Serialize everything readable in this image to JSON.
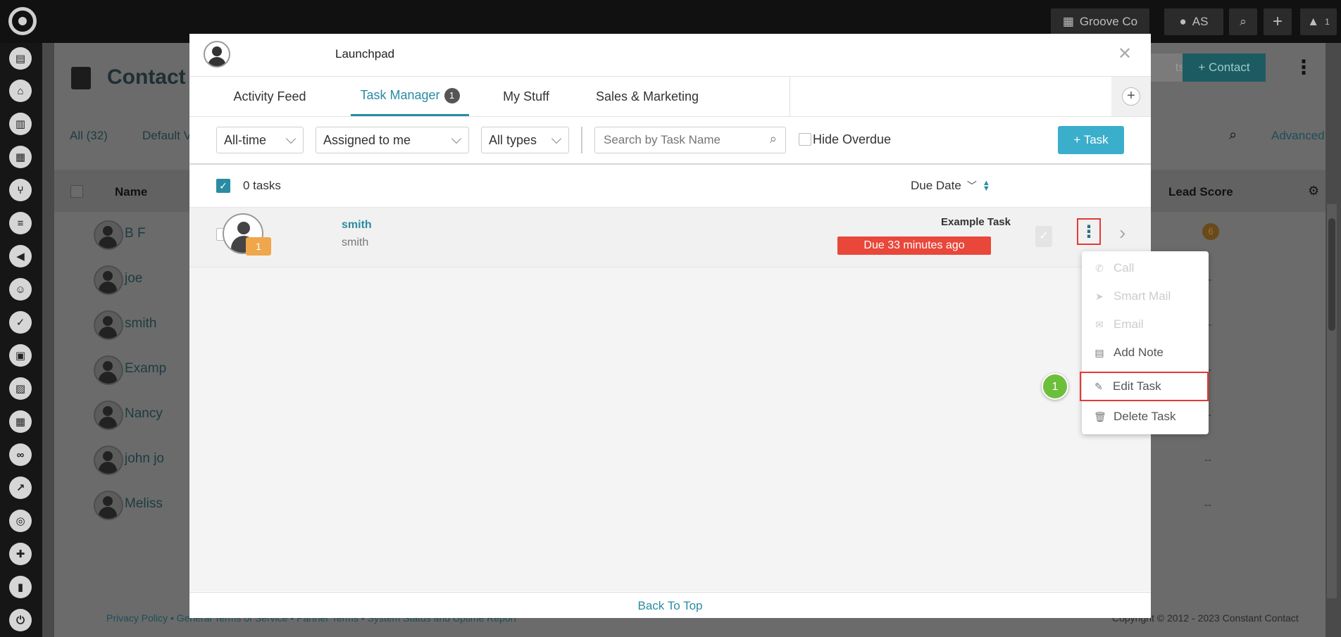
{
  "topbar": {
    "org_label": "Groove Co",
    "user_initials": "AS",
    "notification_count": "1"
  },
  "background": {
    "page_title": "Contact",
    "filter_all": "All (32)",
    "filter_view": "Default V",
    "col_name": "Name",
    "col_lead_score": "Lead Score",
    "btn_contact": "+ Contact",
    "btn_import": "ts",
    "advanced": "Advanced",
    "rows": [
      "B F",
      "joe",
      "smith",
      "Examp",
      "Nancy",
      "john jo",
      "Meliss"
    ],
    "lead_scores": [
      "6",
      "--",
      "--",
      "--",
      "--",
      "--",
      "--"
    ],
    "footer_links": "Privacy Policy • General Terms of Service • Partner Terms • System Status and Uptime Report",
    "copyright": "Copyright © 2012 - 2023 Constant Contact"
  },
  "modal": {
    "title": "Launchpad",
    "tabs": [
      {
        "label": "Activity Feed"
      },
      {
        "label": "Task Manager",
        "badge": "1"
      },
      {
        "label": "My Stuff"
      },
      {
        "label": "Sales & Marketing"
      }
    ],
    "filters": {
      "time": "All-time",
      "assigned": "Assigned to me",
      "types": "All types",
      "search_placeholder": "Search by Task Name",
      "hide_overdue": "Hide Overdue",
      "add_task": "+ Task"
    },
    "list": {
      "count_label": "0 tasks",
      "sort_label": "Due Date"
    },
    "task": {
      "name": "smith",
      "sub": "smith",
      "avatar_badge": "1",
      "title": "Example Task",
      "due": "Due 33 minutes ago"
    },
    "back_to_top": "Back To Top"
  },
  "menu": {
    "items": [
      {
        "label": "Call",
        "icon": "phone-icon",
        "disabled": true
      },
      {
        "label": "Smart Mail",
        "icon": "send-icon",
        "disabled": true
      },
      {
        "label": "Email",
        "icon": "envelope-icon",
        "disabled": true
      },
      {
        "label": "Add Note",
        "icon": "note-icon",
        "disabled": false
      },
      {
        "label": "Edit Task",
        "icon": "pencil-icon",
        "disabled": false
      },
      {
        "label": "Delete Task",
        "icon": "trash-icon",
        "disabled": false
      }
    ]
  },
  "callout": {
    "step": "1"
  },
  "colors": {
    "accent": "#2a8ca3",
    "due": "#e8473a",
    "add_task_btn": "#3aaecb",
    "callout": "#6cbf3a"
  }
}
